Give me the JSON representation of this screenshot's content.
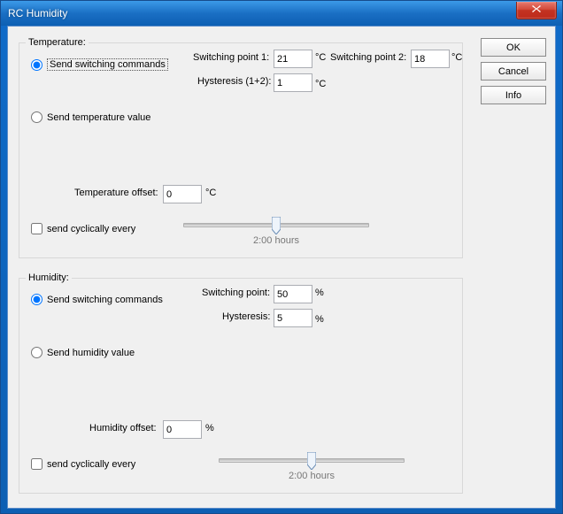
{
  "window": {
    "title": "RC Humidity",
    "close": "X"
  },
  "buttons": {
    "ok": "OK",
    "cancel": "Cancel",
    "info": "Info"
  },
  "temp": {
    "legend": "Temperature:",
    "radio1": "Send switching commands",
    "radio2": "Send temperature value",
    "sp1_label": "Switching point 1:",
    "sp1_value": "21",
    "sp1_unit": "°C",
    "sp2_label": "Switching point 2:",
    "sp2_value": "18",
    "sp2_unit": "°C",
    "hyst_label": "Hysteresis (1+2):",
    "hyst_value": "1",
    "hyst_unit": "°C",
    "offset_label": "Temperature offset:",
    "offset_value": "0",
    "offset_unit": "°C",
    "cyclic": "send cyclically every",
    "tick": "2:00 hours"
  },
  "hum": {
    "legend": "Humidity:",
    "radio1": "Send switching commands",
    "radio2": "Send humidity value",
    "sp_label": "Switching point:",
    "sp_value": "50",
    "sp_unit": "%",
    "hyst_label": "Hysteresis:",
    "hyst_value": "5",
    "hyst_unit": "%",
    "offset_label": "Humidity offset:",
    "offset_value": "0",
    "offset_unit": "%",
    "cyclic": "send cyclically every",
    "tick": "2:00 hours"
  }
}
